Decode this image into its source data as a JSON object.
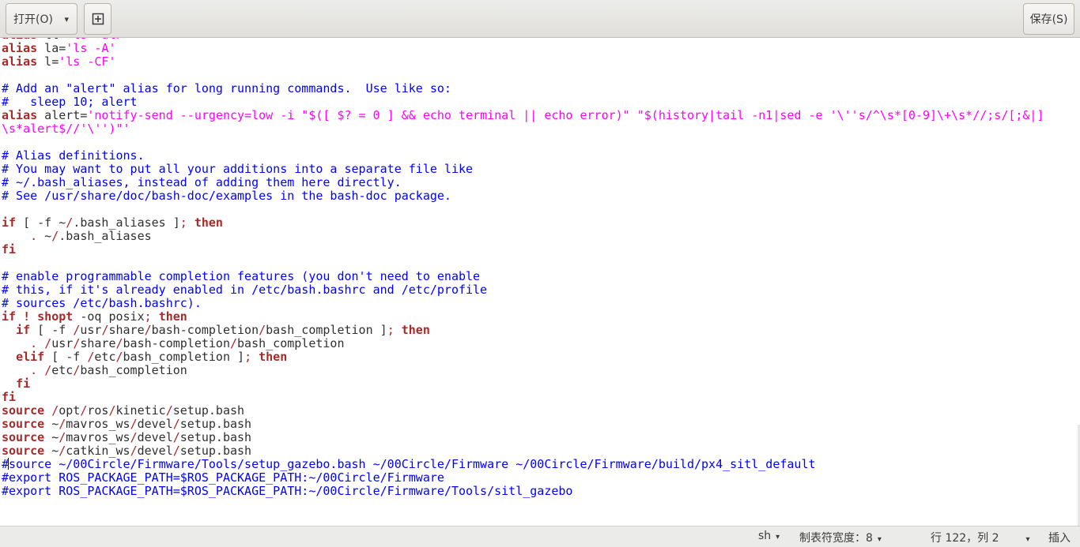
{
  "toolbar": {
    "open_label": "打开(O)",
    "open_caret": "▾",
    "new_doc_icon": "⊞",
    "save_label": "保存(S)"
  },
  "editor": {
    "lines": [
      [
        [
          "kw",
          "alias"
        ],
        [
          "t",
          " ll="
        ],
        [
          "str",
          "'ls -alF'"
        ]
      ],
      [
        [
          "kw",
          "alias"
        ],
        [
          "t",
          " la="
        ],
        [
          "str",
          "'ls -A'"
        ]
      ],
      [
        [
          "kw",
          "alias"
        ],
        [
          "t",
          " l="
        ],
        [
          "str",
          "'ls -CF'"
        ]
      ],
      [],
      [
        [
          "cm",
          "# Add an \"alert\" alias for long running commands.  Use like so:"
        ]
      ],
      [
        [
          "cm",
          "#   sleep 10; alert"
        ]
      ],
      [
        [
          "kw",
          "alias"
        ],
        [
          "t",
          " alert="
        ],
        [
          "str",
          "'notify-send --urgency=low -i \"$([ $? = 0 ] && echo terminal || echo error)\" \"$(history|tail -n1|sed -e '\\''s/^\\s*[0-9]\\+\\s*//;s/[;&|]"
        ]
      ],
      [
        [
          "str",
          "\\s*alert$//'\\'')\"'"
        ]
      ],
      [],
      [
        [
          "cm",
          "# Alias definitions."
        ]
      ],
      [
        [
          "cm",
          "# You may want to put all your additions into a separate file like"
        ]
      ],
      [
        [
          "cm",
          "# ~/.bash_aliases, instead of adding them here directly."
        ]
      ],
      [
        [
          "cm",
          "# See /usr/share/doc/bash-doc/examples in the bash-doc package."
        ]
      ],
      [],
      [
        [
          "kw",
          "if"
        ],
        [
          "t",
          " [ -f ~"
        ],
        [
          "op",
          "/"
        ],
        [
          "t",
          ".bash_aliases ]"
        ],
        [
          "op",
          ";"
        ],
        [
          "t",
          " "
        ],
        [
          "kw",
          "then"
        ]
      ],
      [
        [
          "t",
          "    "
        ],
        [
          "op",
          "."
        ],
        [
          "t",
          " ~"
        ],
        [
          "op",
          "/"
        ],
        [
          "t",
          ".bash_aliases"
        ]
      ],
      [
        [
          "kw",
          "fi"
        ]
      ],
      [],
      [
        [
          "cm",
          "# enable programmable completion features (you don't need to enable"
        ]
      ],
      [
        [
          "cm",
          "# this, if it's already enabled in /etc/bash.bashrc and /etc/profile"
        ]
      ],
      [
        [
          "cm",
          "# sources /etc/bash.bashrc)."
        ]
      ],
      [
        [
          "kw",
          "if"
        ],
        [
          "t",
          " "
        ],
        [
          "kw",
          "!"
        ],
        [
          "t",
          " "
        ],
        [
          "kw",
          "shopt"
        ],
        [
          "t",
          " -oq posix"
        ],
        [
          "op",
          ";"
        ],
        [
          "t",
          " "
        ],
        [
          "kw",
          "then"
        ]
      ],
      [
        [
          "t",
          "  "
        ],
        [
          "kw",
          "if"
        ],
        [
          "t",
          " [ -f "
        ],
        [
          "op",
          "/"
        ],
        [
          "t",
          "usr"
        ],
        [
          "op",
          "/"
        ],
        [
          "t",
          "share"
        ],
        [
          "op",
          "/"
        ],
        [
          "t",
          "bash-completion"
        ],
        [
          "op",
          "/"
        ],
        [
          "t",
          "bash_completion ]"
        ],
        [
          "op",
          ";"
        ],
        [
          "t",
          " "
        ],
        [
          "kw",
          "then"
        ]
      ],
      [
        [
          "t",
          "    "
        ],
        [
          "op",
          "."
        ],
        [
          "t",
          " "
        ],
        [
          "op",
          "/"
        ],
        [
          "t",
          "usr"
        ],
        [
          "op",
          "/"
        ],
        [
          "t",
          "share"
        ],
        [
          "op",
          "/"
        ],
        [
          "t",
          "bash-completion"
        ],
        [
          "op",
          "/"
        ],
        [
          "t",
          "bash_completion"
        ]
      ],
      [
        [
          "t",
          "  "
        ],
        [
          "kw",
          "elif"
        ],
        [
          "t",
          " [ -f "
        ],
        [
          "op",
          "/"
        ],
        [
          "t",
          "etc"
        ],
        [
          "op",
          "/"
        ],
        [
          "t",
          "bash_completion ]"
        ],
        [
          "op",
          ";"
        ],
        [
          "t",
          " "
        ],
        [
          "kw",
          "then"
        ]
      ],
      [
        [
          "t",
          "    "
        ],
        [
          "op",
          "."
        ],
        [
          "t",
          " "
        ],
        [
          "op",
          "/"
        ],
        [
          "t",
          "etc"
        ],
        [
          "op",
          "/"
        ],
        [
          "t",
          "bash_completion"
        ]
      ],
      [
        [
          "t",
          "  "
        ],
        [
          "kw",
          "fi"
        ]
      ],
      [
        [
          "kw",
          "fi"
        ]
      ],
      [
        [
          "kw",
          "source"
        ],
        [
          "t",
          " "
        ],
        [
          "op",
          "/"
        ],
        [
          "t",
          "opt"
        ],
        [
          "op",
          "/"
        ],
        [
          "t",
          "ros"
        ],
        [
          "op",
          "/"
        ],
        [
          "t",
          "kinetic"
        ],
        [
          "op",
          "/"
        ],
        [
          "t",
          "setup.bash"
        ]
      ],
      [
        [
          "kw",
          "source"
        ],
        [
          "t",
          " ~"
        ],
        [
          "op",
          "/"
        ],
        [
          "t",
          "mavros_ws"
        ],
        [
          "op",
          "/"
        ],
        [
          "t",
          "devel"
        ],
        [
          "op",
          "/"
        ],
        [
          "t",
          "setup.bash"
        ]
      ],
      [
        [
          "kw",
          "source"
        ],
        [
          "t",
          " ~"
        ],
        [
          "op",
          "/"
        ],
        [
          "t",
          "mavros_ws"
        ],
        [
          "op",
          "/"
        ],
        [
          "t",
          "devel"
        ],
        [
          "op",
          "/"
        ],
        [
          "t",
          "setup.bash"
        ]
      ],
      [
        [
          "kw",
          "source"
        ],
        [
          "t",
          " ~"
        ],
        [
          "op",
          "/"
        ],
        [
          "t",
          "catkin_ws"
        ],
        [
          "op",
          "/"
        ],
        [
          "t",
          "devel"
        ],
        [
          "op",
          "/"
        ],
        [
          "t",
          "setup.bash"
        ]
      ],
      [
        [
          "cm",
          "#"
        ],
        [
          "cursor",
          ""
        ],
        [
          "cm",
          "source ~/00Circle/Firmware/Tools/setup_gazebo.bash ~/00Circle/Firmware ~/00Circle/Firmware/build/px4_sitl_default"
        ]
      ],
      [
        [
          "cm",
          "#export ROS_PACKAGE_PATH=$ROS_PACKAGE_PATH:~/00Circle/Firmware"
        ]
      ],
      [
        [
          "cm",
          "#export ROS_PACKAGE_PATH=$ROS_PACKAGE_PATH:~/00Circle/Firmware/Tools/sitl_gazebo"
        ]
      ]
    ]
  },
  "statusbar": {
    "language": "sh",
    "tab_width": "制表符宽度：8",
    "position": "行 122，列 2",
    "mode": "插入",
    "dropdown_icon": "▾"
  }
}
